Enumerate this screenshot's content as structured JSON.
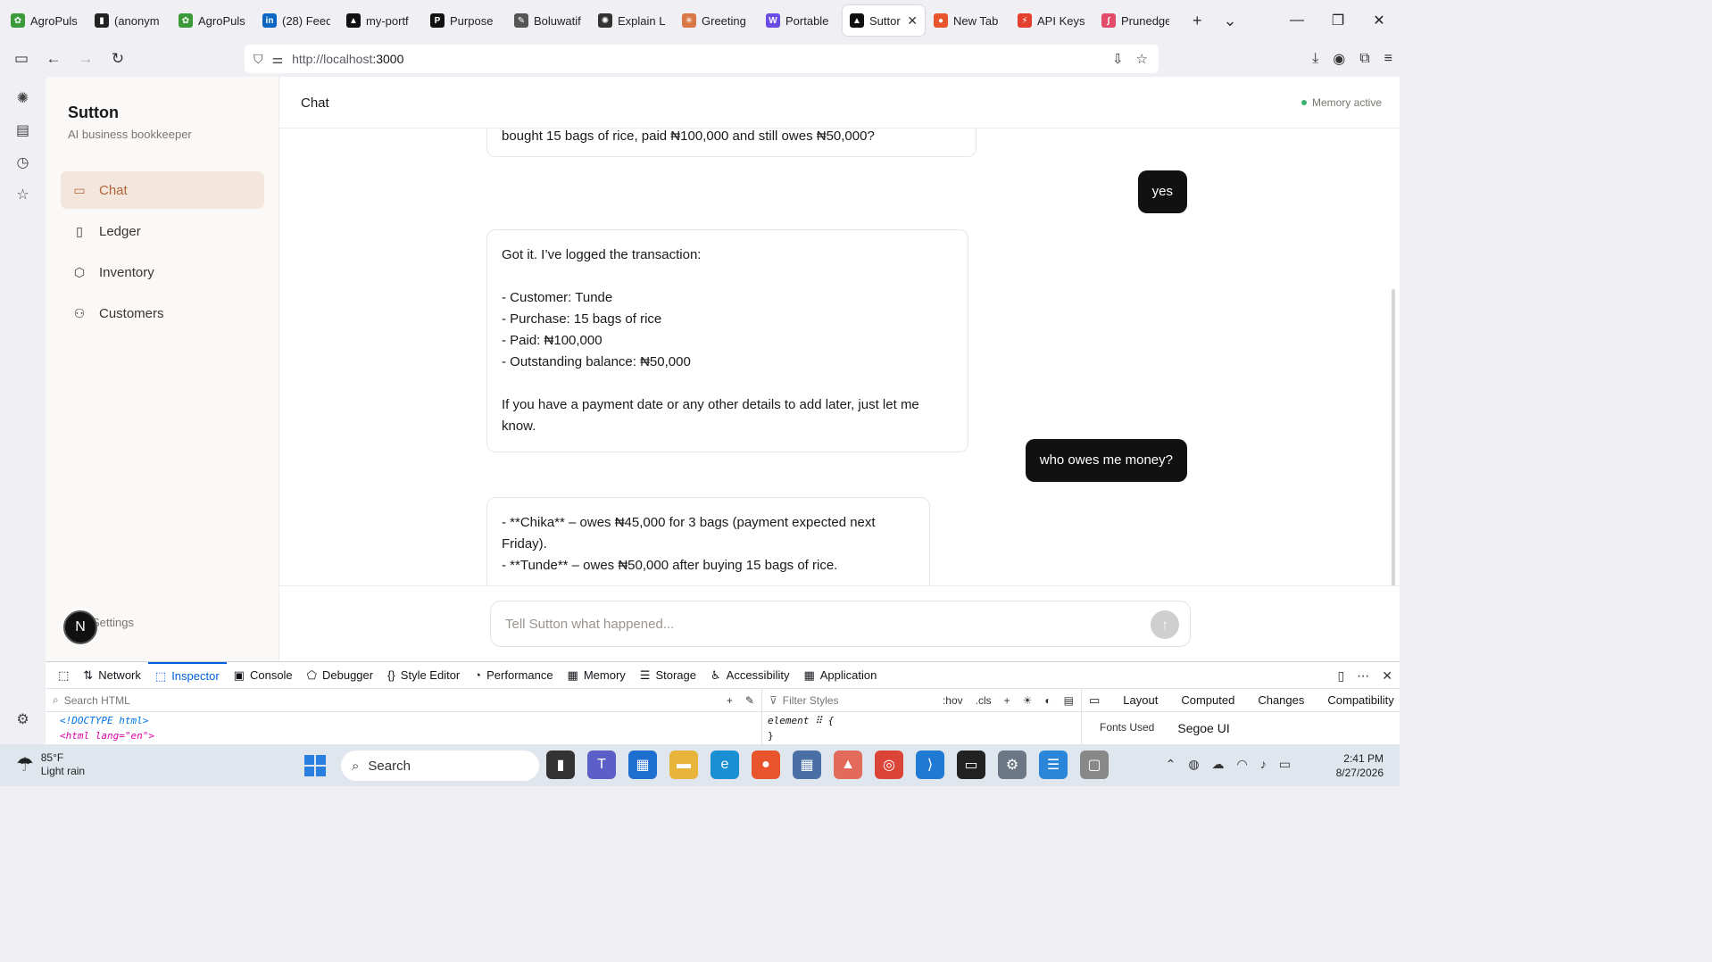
{
  "browser": {
    "tabs": [
      {
        "label": "AgroPuls",
        "color": "#3b9b3b",
        "glyph": "✿"
      },
      {
        "label": "(anonym",
        "color": "#222222",
        "glyph": "▮"
      },
      {
        "label": "AgroPuls",
        "color": "#3b9b3b",
        "glyph": "✿"
      },
      {
        "label": "(28) Feed",
        "color": "#0a66c2",
        "glyph": "in"
      },
      {
        "label": "my-portf",
        "color": "#111111",
        "glyph": "▲"
      },
      {
        "label": "Purpose",
        "color": "#111111",
        "glyph": "P"
      },
      {
        "label": "Boluwatif",
        "color": "#555555",
        "glyph": "✎"
      },
      {
        "label": "Explain L",
        "color": "#333333",
        "glyph": "✺"
      },
      {
        "label": "Greeting",
        "color": "#d97745",
        "glyph": "✳"
      },
      {
        "label": "Portable",
        "color": "#6b4de6",
        "glyph": "W"
      },
      {
        "label": "Suttor",
        "color": "#111111",
        "glyph": "▲",
        "active": true
      },
      {
        "label": "New Tab",
        "color": "#e8552d",
        "glyph": "●"
      },
      {
        "label": "API Keys",
        "color": "#e53f2e",
        "glyph": "⚡"
      },
      {
        "label": "Prunedge",
        "color": "#e24b6a",
        "glyph": "∫"
      }
    ],
    "url_host": "http://localhost",
    "url_port": ":3000"
  },
  "app": {
    "brand": "Sutton",
    "tagline": "AI business bookkeeper",
    "nav": [
      {
        "label": "Chat",
        "icon": "▭",
        "active": true
      },
      {
        "label": "Ledger",
        "icon": "▯"
      },
      {
        "label": "Inventory",
        "icon": "⬡"
      },
      {
        "label": "Customers",
        "icon": "⚇"
      }
    ],
    "avatar_initial": "N",
    "settings_label": "Settings",
    "header_title": "Chat",
    "memory_status": "Memory active",
    "messages": [
      {
        "role": "assistant",
        "text": "bought 15 bags of rice, paid ₦100,000 and still owes ₦50,000?"
      },
      {
        "role": "user",
        "text": "yes"
      },
      {
        "role": "assistant",
        "text": "Got it. I’ve logged the transaction:\n\n- Customer: Tunde\n- Purchase: 15 bags of rice\n- Paid: ₦100,000\n- Outstanding balance: ₦50,000\n\nIf you have a payment date or any other details to add later, just let me know."
      },
      {
        "role": "user",
        "text": "who owes me money?"
      },
      {
        "role": "assistant",
        "text": "- **Chika** – owes ₦45,000 for 3 bags (payment expected next Friday).\n- **Tunde** – owes ₦50,000 after buying 15 bags of rice."
      }
    ],
    "composer_placeholder": "Tell Sutton what happened..."
  },
  "devtools": {
    "tabs": [
      {
        "label": "Network",
        "icon": "⇅"
      },
      {
        "label": "Inspector",
        "icon": "⬚",
        "active": true
      },
      {
        "label": "Console",
        "icon": "▣"
      },
      {
        "label": "Debugger",
        "icon": "⬠"
      },
      {
        "label": "Style Editor",
        "icon": "{}"
      },
      {
        "label": "Performance",
        "icon": "◔"
      },
      {
        "label": "Memory",
        "icon": "▦"
      },
      {
        "label": "Storage",
        "icon": "☰"
      },
      {
        "label": "Accessibility",
        "icon": "♿"
      },
      {
        "label": "Application",
        "icon": "▦"
      }
    ],
    "search_html_placeholder": "Search HTML",
    "html_line1": "<!DOCTYPE html>",
    "html_line2": "<html lang=\"en\">",
    "filter_styles_placeholder": "Filter Styles",
    "hov": ":hov",
    "cls": ".cls",
    "rule_line1": "element ⠿ {",
    "rule_line2": "}",
    "layout_tabs": [
      "Layout",
      "Computed",
      "Changes",
      "Compatibility"
    ],
    "fonts_used_label": "Fonts Used",
    "fonts_used_value": "Segoe UI"
  },
  "taskbar": {
    "temp": "85°F",
    "condition": "Light rain",
    "search_label": "Search",
    "time": "2:41 PM",
    "date": "8/27/2026"
  }
}
